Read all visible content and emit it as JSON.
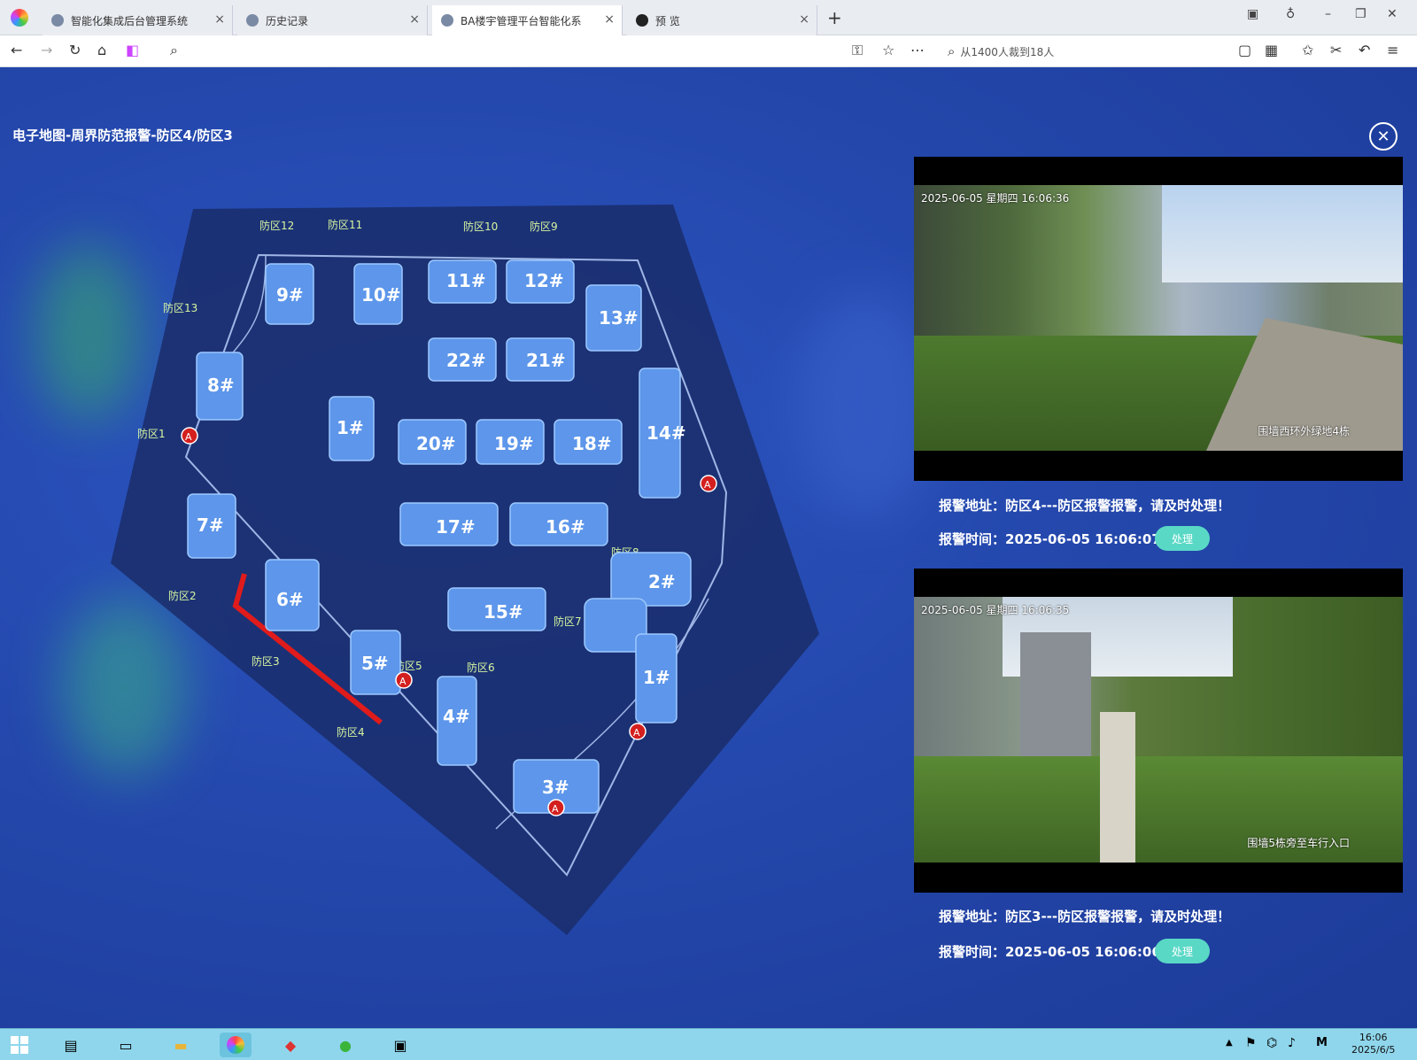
{
  "browser": {
    "tabs": [
      {
        "title": "智能化集成后台管理系统",
        "active": false
      },
      {
        "title": "历史记录",
        "active": false
      },
      {
        "title": "BA楼宇管理平台智能化系",
        "active": true
      },
      {
        "title": "预 览",
        "active": false
      }
    ],
    "new_tab": "+",
    "tab_close": "×",
    "search_text": "从1400人裁到18人",
    "controls": {
      "minimize": "–",
      "restore": "❐",
      "close": "✕"
    }
  },
  "page": {
    "title": "电子地图-周界防范报警-防区4/防区3",
    "close_glyph": "✕"
  },
  "map": {
    "zones": [
      "防区12",
      "防区11",
      "防区10",
      "防区9",
      "防区13",
      "防区1",
      "防区2",
      "防区3",
      "防区4",
      "防区5",
      "防区6",
      "防区7",
      "防区8"
    ],
    "buildings": [
      "9#",
      "10#",
      "11#",
      "12#",
      "13#",
      "22#",
      "21#",
      "8#",
      "1#",
      "20#",
      "19#",
      "18#",
      "14#",
      "7#",
      "17#",
      "16#",
      "2#",
      "6#",
      "15#",
      "5#",
      "4#",
      "1#",
      "3#"
    ],
    "pin_glyph": "A"
  },
  "alarms": [
    {
      "osd": "2025-06-05 星期四 16:06:36",
      "cam_tag": "围墙西环外绿地4栋",
      "address_label": "报警地址：",
      "address": "防区4---防区报警报警，请及时处理！",
      "time_label": "报警时间：",
      "time": "2025-06-05 16:06:07",
      "button": "处理"
    },
    {
      "osd": "2025-06-05 星期四 16:06:35",
      "cam_tag": "围墙5栋旁至车行入口",
      "address_label": "报警地址：",
      "address": "防区3---防区报警报警，请及时处理！",
      "time_label": "报警时间：",
      "time": "2025-06-05 16:06:06",
      "button": "处理"
    }
  ],
  "taskbar": {
    "time": "16:06",
    "date": "2025/6/5"
  },
  "colors": {
    "background": "#2448ad",
    "map_base": "#1b2f6e",
    "building": "#5d96ea",
    "alarm_line": "#e01b1b",
    "process_button": "#5ad8c6",
    "zone_text": "#d6f5a0"
  }
}
